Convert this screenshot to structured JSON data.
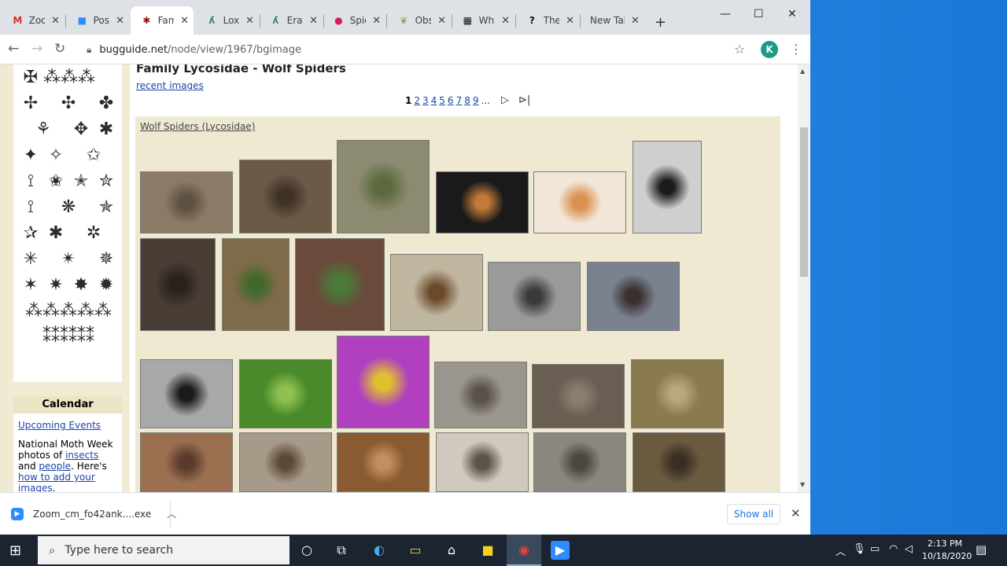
{
  "browser": {
    "tabs": [
      {
        "title": "Zoo",
        "icon": "gmail-icon",
        "color": "#d93025",
        "glyph": "M",
        "active": false
      },
      {
        "title": "Post",
        "icon": "zoom-icon",
        "color": "#2d8cff",
        "glyph": "■",
        "active": false
      },
      {
        "title": "Fam",
        "icon": "bug-icon",
        "color": "#a01010",
        "glyph": "✱",
        "active": true
      },
      {
        "title": "Loxo",
        "icon": "leaf-icon",
        "color": "#2e8b57",
        "glyph": "ʎ",
        "active": false
      },
      {
        "title": "Erat",
        "icon": "leaf-icon",
        "color": "#2e8b57",
        "glyph": "ʎ",
        "active": false
      },
      {
        "title": "Spid",
        "icon": "circle-icon",
        "color": "#d81b60",
        "glyph": "●",
        "active": false
      },
      {
        "title": "Obs",
        "icon": "leaf-icon",
        "color": "#7cb342",
        "glyph": "❦",
        "active": false
      },
      {
        "title": "Why",
        "icon": "pattern-icon",
        "color": "#111111",
        "glyph": "▦",
        "active": false
      },
      {
        "title": "The",
        "icon": "question-icon",
        "color": "#111111",
        "glyph": "?",
        "active": false
      },
      {
        "title": "New Tab",
        "icon": "",
        "color": "#333333",
        "glyph": "",
        "active": false
      }
    ],
    "url_host": "bugguide.net",
    "url_path": "/node/view/1967/bgimage",
    "avatar_letter": "K"
  },
  "page": {
    "family_title": "Family Lycosidae - Wolf Spiders",
    "recent_link": "recent images",
    "pager": {
      "current": "1",
      "pages": [
        "2",
        "3",
        "4",
        "5",
        "6",
        "7",
        "8",
        "9"
      ],
      "ellipsis": "...",
      "next_icon": "▷",
      "last_icon": "⊳|"
    },
    "gallery_title": "Wolf Spiders (Lycosidae)",
    "thumbnails": [
      {
        "row": 1,
        "colors": [
          "#8a7a66",
          "#5e5142"
        ]
      },
      {
        "row": 1,
        "colors": [
          "#6b5a48",
          "#3f3126"
        ]
      },
      {
        "row": 1,
        "colors": [
          "#8c8a70",
          "#5a6a3e"
        ]
      },
      {
        "row": 1,
        "colors": [
          "#1a1a1a",
          "#c27a3a"
        ]
      },
      {
        "row": 1,
        "colors": [
          "#f2e6d8",
          "#d9914e"
        ]
      },
      {
        "row": 1,
        "colors": [
          "#cfcfcf",
          "#1c1c1c"
        ]
      },
      {
        "row": 2,
        "colors": [
          "#4a3d36",
          "#2a211c"
        ]
      },
      {
        "row": 2,
        "colors": [
          "#7f6a4a",
          "#3f6a2a"
        ]
      },
      {
        "row": 2,
        "colors": [
          "#6a4a3a",
          "#4a7a3a"
        ]
      },
      {
        "row": 2,
        "colors": [
          "#c0b6a0",
          "#6a4a2a"
        ]
      },
      {
        "row": 2,
        "colors": [
          "#9a9a98",
          "#3a3a3a"
        ]
      },
      {
        "row": 2,
        "colors": [
          "#7a8290",
          "#3a3030"
        ]
      },
      {
        "row": 3,
        "colors": [
          "#a8a8aa",
          "#1a1a1a"
        ]
      },
      {
        "row": 3,
        "colors": [
          "#4a8a2a",
          "#8fc050"
        ]
      },
      {
        "row": 3,
        "colors": [
          "#b040c0",
          "#e0c030"
        ]
      },
      {
        "row": 3,
        "colors": [
          "#9a968e",
          "#5a524a"
        ]
      },
      {
        "row": 3,
        "colors": [
          "#6a5e52",
          "#8a7e70"
        ]
      },
      {
        "row": 3,
        "colors": [
          "#8a7a50",
          "#b8a880"
        ]
      },
      {
        "row": 4,
        "colors": [
          "#9a7050",
          "#5a3a2a"
        ]
      },
      {
        "row": 4,
        "colors": [
          "#a89a88",
          "#5a4a3a"
        ]
      },
      {
        "row": 4,
        "colors": [
          "#8a5a30",
          "#c09060"
        ]
      },
      {
        "row": 4,
        "colors": [
          "#d0cabe",
          "#5a5448"
        ]
      },
      {
        "row": 4,
        "colors": [
          "#8a8680",
          "#4a4640"
        ]
      },
      {
        "row": 4,
        "colors": [
          "#6a5a40",
          "#3a2e22"
        ]
      }
    ],
    "sidebar": {
      "calendar_title": "Calendar",
      "upcoming_events": "Upcoming Events",
      "moth_text_1": "National Moth Week photos of ",
      "moth_link_insects": "insects",
      "moth_text_2": " and ",
      "moth_link_people": "people",
      "moth_text_3": ". Here's ",
      "moth_link_howto": "how to add your images",
      "moth_text_4": "."
    }
  },
  "download_bar": {
    "filename": "Zoom_cm_fo42ank....exe",
    "show_all": "Show all"
  },
  "taskbar": {
    "search_placeholder": "Type here to search",
    "time": "2:13 PM",
    "date": "10/18/2020",
    "notification_count": "2"
  }
}
